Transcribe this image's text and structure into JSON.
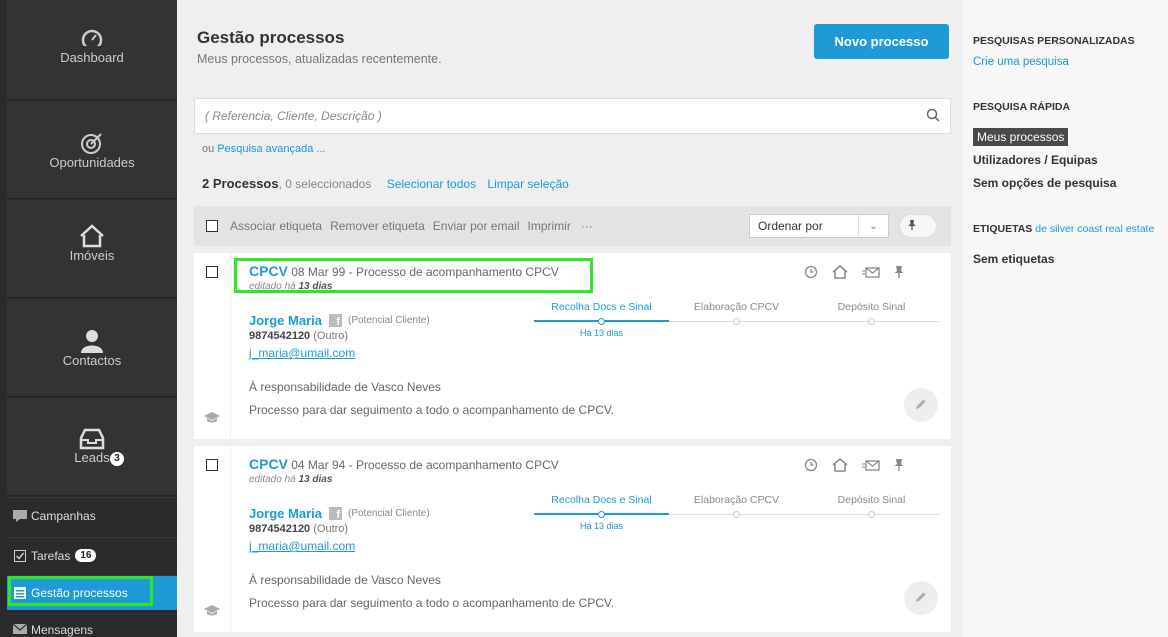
{
  "sidebar": {
    "big": [
      {
        "label": "Dashboard",
        "icon": "gauge-icon"
      },
      {
        "label": "Oportunidades",
        "icon": "target-icon"
      },
      {
        "label": "Imóveis",
        "icon": "house-icon"
      },
      {
        "label": "Contactos",
        "icon": "person-icon"
      },
      {
        "label": "Leads",
        "icon": "inbox-icon",
        "badge": "3"
      }
    ],
    "small": [
      {
        "label": "Campanhas",
        "icon": "chat-icon"
      },
      {
        "label": "Tarefas",
        "icon": "checkbox-icon",
        "badge": "16"
      },
      {
        "label": "Gestão processos",
        "icon": "list-icon"
      },
      {
        "label": "Mensagens",
        "icon": "envelope-icon"
      }
    ]
  },
  "header": {
    "title": "Gestão processos",
    "subtitle": "Meus processos, atualizadas recentemente.",
    "new_button": "Novo processo"
  },
  "search": {
    "placeholder": "( Referencia, Cliente, Descrição )",
    "advanced_prefix": "ou",
    "advanced_link": "Pesquisa avançada ..."
  },
  "summary": {
    "count": "2 Processos",
    "selected": ", 0 seleccionados",
    "select_all": "Selecionar todos",
    "clear": "Limpar seleção"
  },
  "toolbar": {
    "tag": "Associar etiqueta",
    "untag": "Remover etiqueta",
    "email": "Enviar por email",
    "print": "Imprimir",
    "more": "···",
    "sort_label": "Ordenar por"
  },
  "processes": [
    {
      "ref": "CPCV",
      "date": "08 Mar",
      "title": "99 - Processo de acompanhamento CPCV",
      "edited_prefix": "editado há",
      "edited_ago": "13 dias",
      "client": "Jorge Maria",
      "client_type": "(Potencial Cliente)",
      "phone": "9874542120",
      "phone_type": "(Outro)",
      "email": "j_maria@umail.com",
      "responsible": "À responsabilidade de Vasco Neves",
      "description": "Processo para dar seguimento a todo o acompanhamento de CPCV.",
      "stages": [
        "Recolha Docs e Sinal",
        "Elaboração CPCV",
        "Depósito Sinal"
      ],
      "stage_ago": "Há 13 dias"
    },
    {
      "ref": "CPCV",
      "date": "04 Mar",
      "title": "94 - Processo de acompanhamento CPCV",
      "edited_prefix": "editado há",
      "edited_ago": "13 dias",
      "client": "Jorge Maria",
      "client_type": "(Potencial Cliente)",
      "phone": "9874542120",
      "phone_type": "(Outro)",
      "email": "j_maria@umail.com",
      "responsible": "À responsabilidade de Vasco Neves",
      "description": "Processo para dar seguimento a todo o acompanhamento de CPCV.",
      "stages": [
        "Recolha Docs e Sinal",
        "Elaboração CPCV",
        "Depósito Sinal"
      ],
      "stage_ago": "Há 13 dias"
    }
  ],
  "right": {
    "custom_heading": "PESQUISAS PERSONALIZADAS",
    "custom_link": "Crie uma pesquisa",
    "quick_heading": "PESQUISA RÁPIDA",
    "quick_items": [
      "Meus processos",
      "Utilizadores / Equipas",
      "Sem opções de pesquisa"
    ],
    "tags_heading": "ETIQUETAS",
    "tags_of": "de silver coast real estate",
    "no_tags": "Sem etiquetas"
  },
  "colors": {
    "accent": "#1e9ad6",
    "sidebar": "#2b2b2b",
    "highlight": "#2ee824"
  }
}
